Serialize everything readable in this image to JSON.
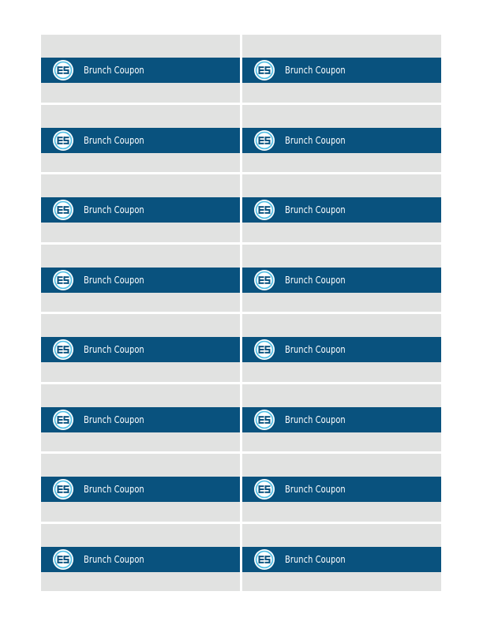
{
  "colors": {
    "page": "#ffffff",
    "coupon_background": "#e1e2e1",
    "band": "#09527e",
    "logo_ring": "#4fbde3",
    "text": "#ffffff"
  },
  "coupon_label": "Brunch Coupon",
  "logo_icon": "es-monogram-icon",
  "layout": {
    "rows": 8,
    "columns": 2
  }
}
